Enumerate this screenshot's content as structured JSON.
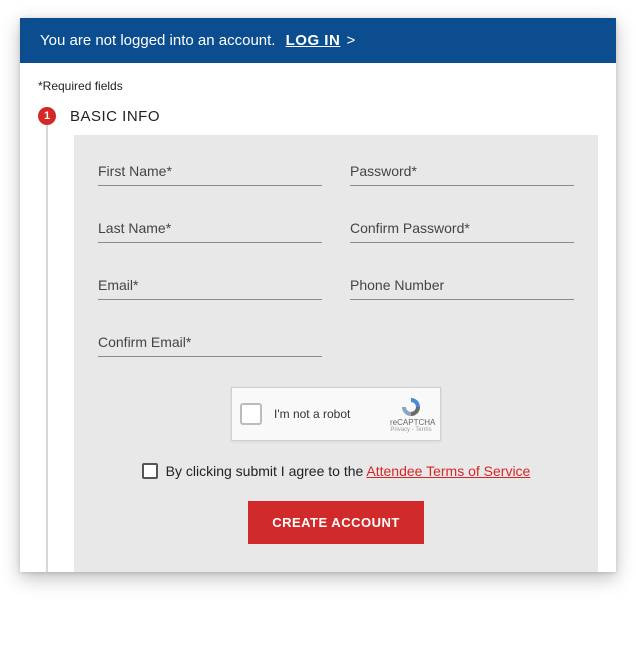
{
  "banner": {
    "message": "You are not logged into an account.",
    "login_label": "LOG IN",
    "arrow": ">"
  },
  "required_note": "*Required fields",
  "step": {
    "number": "1",
    "title": "BASIC INFO"
  },
  "fields": {
    "first_name": "First Name*",
    "last_name": "Last Name*",
    "email": "Email*",
    "confirm_email": "Confirm Email*",
    "password": "Password*",
    "confirm_password": "Confirm Password*",
    "phone": "Phone Number"
  },
  "captcha": {
    "label": "I'm not a robot",
    "brand": "reCAPTCHA",
    "legal": "Privacy  -  Terms"
  },
  "agree": {
    "text": "By clicking submit I agree to the ",
    "link": "Attendee Terms of Service"
  },
  "submit_label": "CREATE ACCOUNT"
}
